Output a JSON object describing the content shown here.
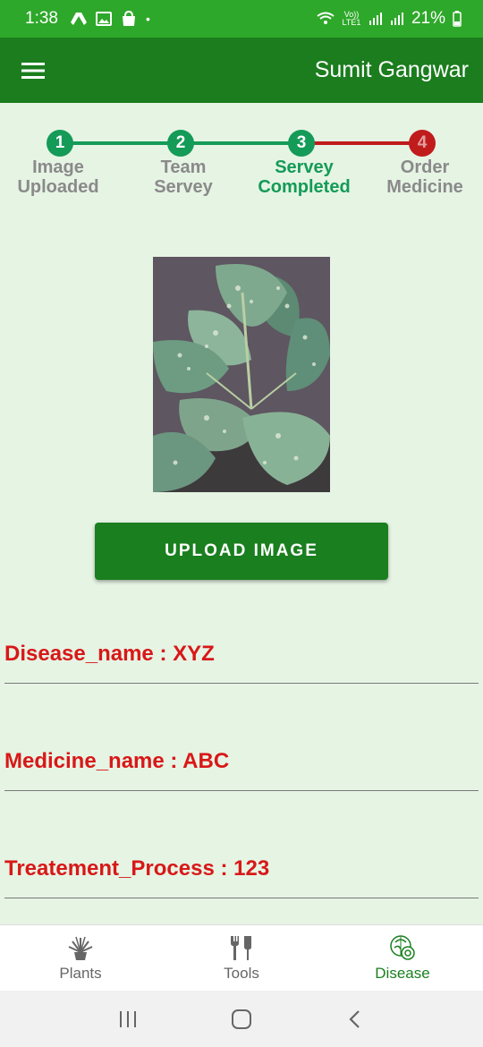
{
  "status_bar": {
    "time": "1:38",
    "battery": "21%",
    "network": "Vo)) LTE1"
  },
  "app_bar": {
    "title": "Sumit Gangwar"
  },
  "stepper": {
    "steps": [
      {
        "number": "1",
        "label_line1": "Image",
        "label_line2": "Uploaded",
        "state": "done"
      },
      {
        "number": "2",
        "label_line1": "Team",
        "label_line2": "Servey",
        "state": "done"
      },
      {
        "number": "3",
        "label_line1": "Servey",
        "label_line2": "Completed",
        "state": "current"
      },
      {
        "number": "4",
        "label_line1": "Order",
        "label_line2": "Medicine",
        "state": "pending"
      }
    ],
    "colors": {
      "done": "#149b57",
      "pending": "#c01c1c",
      "label_done": "#8a8a8a",
      "label_current": "#149b57"
    }
  },
  "upload_button": {
    "label": "UPLOAD IMAGE"
  },
  "info": {
    "disease": "Disease_name : XYZ",
    "medicine": "Medicine_name : ABC",
    "process": "Treatement_Process : 123"
  },
  "bottom_nav": {
    "items": [
      {
        "label": "Plants",
        "icon": "plant-icon"
      },
      {
        "label": "Tools",
        "icon": "tools-icon"
      },
      {
        "label": "Disease",
        "icon": "disease-icon"
      }
    ],
    "active": "Disease"
  },
  "colors": {
    "accent": "#1a7f1f",
    "status_bar": "#2ea82a",
    "background": "#e6f4e4",
    "info_text": "#d81818"
  }
}
